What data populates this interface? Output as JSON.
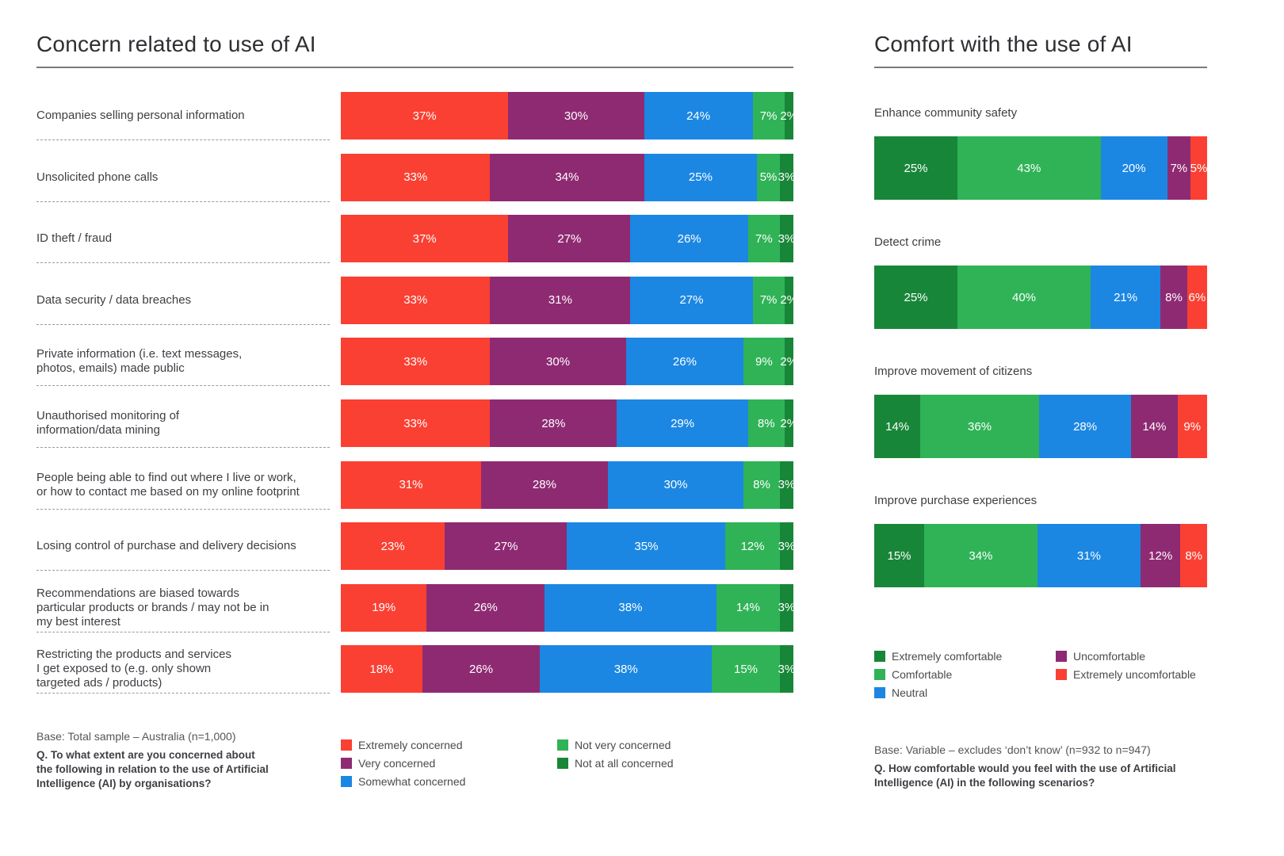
{
  "colors": {
    "extreme_neg": "#fa4032",
    "very_neg": "#8e2a72",
    "neutral": "#1b87e3",
    "light_pos": "#2fb356",
    "strong_pos": "#188638"
  },
  "chart_data": [
    {
      "type": "bar",
      "orientation": "horizontal",
      "stacked": true,
      "title": "Concern related to use of AI",
      "xlim": [
        0,
        100
      ],
      "unit": "%",
      "categories": [
        "Companies selling personal information",
        "Unsolicited phone calls",
        "ID theft / fraud",
        "Data security / data breaches",
        "Private information (i.e. text messages, photos, emails) made public",
        "Unauthorised monitoring of information/data mining",
        "People being able to find out where I live or work, or how to contact me based on my online footprint",
        "Losing control of purchase and delivery decisions",
        "Recommendations are biased towards particular products or brands / may not be in my best interest",
        "Restricting the products and services I get exposed to (e.g. only shown targeted ads / products)"
      ],
      "category_lines": [
        [
          "Companies selling personal information"
        ],
        [
          "Unsolicited phone calls"
        ],
        [
          "ID theft / fraud"
        ],
        [
          "Data security / data breaches"
        ],
        [
          "Private information (i.e. text messages,",
          "photos, emails) made public"
        ],
        [
          "Unauthorised monitoring of",
          "information/data mining"
        ],
        [
          "People being able to find out where I live or work,",
          "or how to contact me based on my online footprint"
        ],
        [
          "Losing control of purchase and delivery decisions"
        ],
        [
          "Recommendations are biased towards",
          "particular products or brands / may not be in",
          "my best interest"
        ],
        [
          "Restricting the products and services",
          "I get exposed to (e.g. only shown",
          "targeted ads / products)"
        ]
      ],
      "series": [
        {
          "name": "Extremely concerned",
          "color": "#fa4032",
          "values": [
            37,
            33,
            37,
            33,
            33,
            33,
            31,
            23,
            19,
            18
          ]
        },
        {
          "name": "Very concerned",
          "color": "#8e2a72",
          "values": [
            30,
            34,
            27,
            31,
            30,
            28,
            28,
            27,
            26,
            26
          ]
        },
        {
          "name": "Somewhat concerned",
          "color": "#1b87e3",
          "values": [
            24,
            25,
            26,
            27,
            26,
            29,
            30,
            35,
            38,
            38
          ]
        },
        {
          "name": "Not very concerned",
          "color": "#2fb356",
          "values": [
            7,
            5,
            7,
            7,
            9,
            8,
            8,
            12,
            14,
            15
          ]
        },
        {
          "name": "Not at all concerned",
          "color": "#188638",
          "values": [
            2,
            3,
            3,
            2,
            2,
            2,
            3,
            3,
            3,
            3
          ]
        }
      ],
      "legend_position": "bottom",
      "legend_columns": [
        [
          "Extremely concerned",
          "Very concerned",
          "Somewhat concerned"
        ],
        [
          "Not very concerned",
          "Not at all concerned"
        ]
      ],
      "base_note": "Base: Total sample – Australia (n=1,000)",
      "question": "Q. To what extent are you concerned about the following in relation to the use of Artificial Intelligence (AI) by organisations?",
      "question_lines": [
        "Q. To what extent are you concerned about",
        "the following in relation to the use of Artificial",
        "Intelligence (AI) by organisations?"
      ]
    },
    {
      "type": "bar",
      "orientation": "horizontal",
      "stacked": true,
      "title": "Comfort with the use of AI",
      "xlim": [
        0,
        100
      ],
      "unit": "%",
      "categories": [
        "Enhance community safety",
        "Detect crime",
        "Improve movement of citizens",
        "Improve purchase experiences"
      ],
      "series": [
        {
          "name": "Extremely comfortable",
          "color": "#188638",
          "values": [
            25,
            25,
            14,
            15
          ]
        },
        {
          "name": "Comfortable",
          "color": "#2fb356",
          "values": [
            43,
            40,
            36,
            34
          ]
        },
        {
          "name": "Neutral",
          "color": "#1b87e3",
          "values": [
            20,
            21,
            28,
            31
          ]
        },
        {
          "name": "Uncomfortable",
          "color": "#8e2a72",
          "values": [
            7,
            8,
            14,
            12
          ]
        },
        {
          "name": "Extremely uncomfortable",
          "color": "#fa4032",
          "values": [
            5,
            6,
            9,
            8
          ]
        }
      ],
      "legend_position": "bottom",
      "legend_columns": [
        [
          "Extremely comfortable",
          "Comfortable",
          "Neutral"
        ],
        [
          "Uncomfortable",
          "Extremely uncomfortable"
        ]
      ],
      "base_note": "Base: Variable – excludes ‘don’t know’ (n=932 to n=947)",
      "question": "Q. How comfortable would you feel with the use of Artificial Intelligence (AI) in the following scenarios?",
      "question_lines": [
        "Q. How comfortable would you feel with the use of Artificial",
        "Intelligence (AI) in the following scenarios?"
      ]
    }
  ]
}
